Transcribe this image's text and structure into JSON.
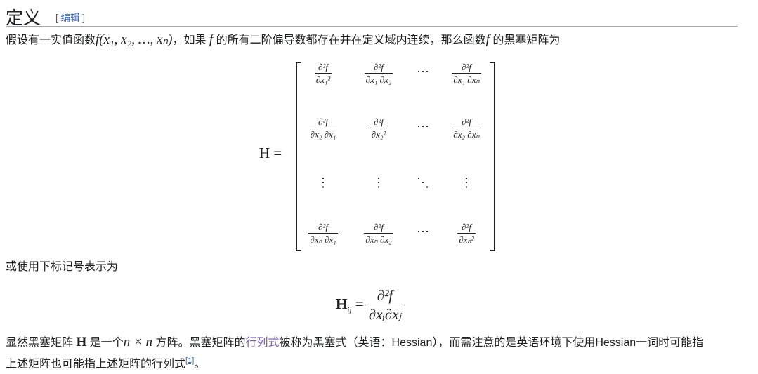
{
  "section": {
    "title": "定义",
    "edit_open": "[",
    "edit_label": "编辑",
    "edit_close": "]"
  },
  "para1": {
    "t1": "假设有一实值函数",
    "f": "f",
    "args": "(x₁, x₂, …, xₙ)",
    "t2": "，如果",
    "f2": "f",
    "t3": "的所有二阶偏导数都存在并在定义域内连续，那么函数",
    "f3": "f",
    "t4": "的黑塞矩阵为"
  },
  "matrix": {
    "lhs": "H =",
    "cells": [
      [
        "∂²f",
        "∂x₁²",
        "∂²f",
        "∂x₁ ∂x₂",
        "⋯",
        "∂²f",
        "∂x₁ ∂xₙ"
      ],
      [
        "∂²f",
        "∂x₂ ∂x₁",
        "∂²f",
        "∂x₂²",
        "⋯",
        "∂²f",
        "∂x₂ ∂xₙ"
      ],
      [
        "⋮",
        "⋮",
        "⋱",
        "⋮"
      ],
      [
        "∂²f",
        "∂xₙ ∂x₁",
        "∂²f",
        "∂xₙ ∂x₂",
        "⋯",
        "∂²f",
        "∂xₙ²"
      ]
    ]
  },
  "para2": {
    "text": "或使用下标记号表示为"
  },
  "eq2": {
    "lhs": "H",
    "sub": "ij",
    "eq": " = ",
    "num": "∂²f",
    "den": "∂xᵢ∂xⱼ"
  },
  "para3": {
    "t1": "显然黑塞矩阵",
    "H": "H",
    "t2": "是一个",
    "nxn": "n × n",
    "t3": "方阵。黑塞矩阵的",
    "link": "行列式",
    "t4": "被称为黑塞式（英语：Hessian），而需注意的是英语环境下使用Hessian一词时可能指",
    "t5": "上述矩阵也可能指上述矩阵的行列式",
    "ref": "[1]",
    "t6": "。"
  }
}
